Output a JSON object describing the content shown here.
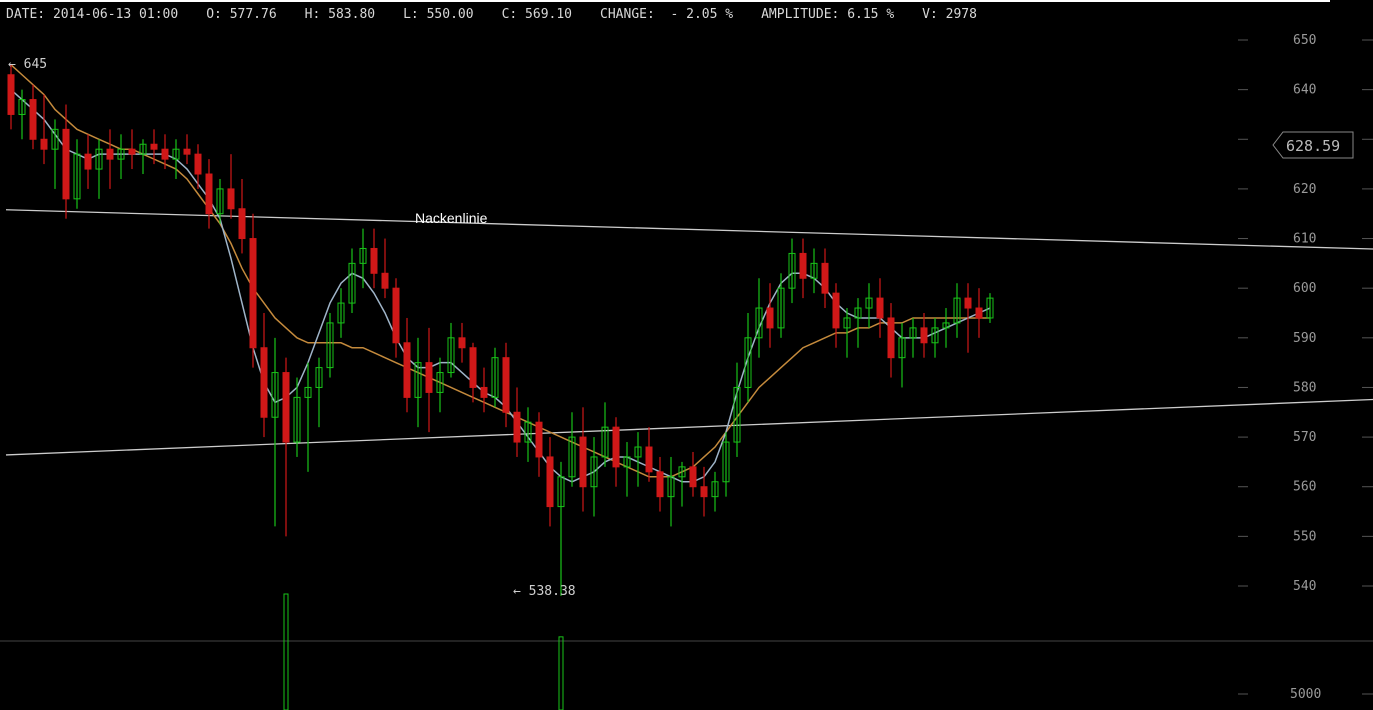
{
  "info_bar": {
    "date_label": "DATE:",
    "date": "2014-06-13 01:00",
    "open_label": "O:",
    "open": "577.76",
    "high_label": "H:",
    "high": "583.80",
    "low_label": "L:",
    "low": "550.00",
    "close_label": "C:",
    "close": "569.10",
    "change_label": "CHANGE:",
    "change": "- 2.05 %",
    "amplitude_label": "AMPLITUDE:",
    "amplitude": "6.15 %",
    "volume_label": "V:",
    "volume": "2978"
  },
  "price_badge": "628.59",
  "colors": {
    "up": "#19c319",
    "down": "#d01818",
    "ma_fast": "#9fb4c8",
    "ma_slow": "#c48a3c",
    "arrow": "#1fa83c",
    "trendline": "#cccccc"
  },
  "chart_data": {
    "type": "candlestick",
    "y_axis": {
      "ticks": [
        540,
        550,
        560,
        570,
        580,
        590,
        600,
        610,
        620,
        630,
        640,
        650
      ],
      "range": [
        533,
        652
      ]
    },
    "volume_axis": {
      "ticks": [
        5000
      ]
    },
    "annotations": {
      "high_marker": "← 645",
      "low_marker": "← 538.38",
      "neckline_label": "Nackenlinie"
    },
    "trendlines": [
      {
        "name": "neckline",
        "from": [
          0,
          615.8
        ],
        "to": [
          248,
          600
        ]
      },
      {
        "name": "support",
        "from": [
          0,
          566.4
        ],
        "to": [
          248,
          588.7
        ]
      }
    ],
    "arrow": {
      "shaft_from": [
        209,
        604.5
      ],
      "tip": [
        216,
        642
      ],
      "left_wing": [
        203,
        629.5
      ],
      "right_wing": [
        225,
        624.3
      ]
    },
    "candles": [
      [
        643,
        645,
        632,
        635
      ],
      [
        635,
        640,
        630,
        638
      ],
      [
        638,
        641,
        628,
        630
      ],
      [
        630,
        639,
        625,
        628
      ],
      [
        628,
        634,
        620,
        632
      ],
      [
        632,
        637,
        614,
        618
      ],
      [
        618,
        630,
        616,
        627
      ],
      [
        627,
        631,
        620,
        624
      ],
      [
        624,
        630,
        618,
        628
      ],
      [
        628,
        632,
        620,
        626
      ],
      [
        626,
        631,
        622,
        628
      ],
      [
        628,
        632,
        624,
        627
      ],
      [
        627,
        630,
        623,
        629
      ],
      [
        629,
        632,
        625,
        628
      ],
      [
        628,
        631,
        624,
        626
      ],
      [
        626,
        630,
        622,
        628
      ],
      [
        628,
        631,
        625,
        627
      ],
      [
        627,
        629,
        620,
        623
      ],
      [
        623,
        626,
        612,
        615
      ],
      [
        615,
        622,
        613,
        620
      ],
      [
        620,
        627,
        614,
        616
      ],
      [
        616,
        622,
        607,
        610
      ],
      [
        610,
        615,
        584,
        588
      ],
      [
        588,
        595,
        570,
        574
      ],
      [
        574,
        590,
        552,
        583
      ],
      [
        583,
        586,
        550,
        569
      ],
      [
        569,
        582,
        566,
        578
      ],
      [
        578,
        585,
        563,
        580
      ],
      [
        580,
        586,
        572,
        584
      ],
      [
        584,
        595,
        582,
        593
      ],
      [
        593,
        600,
        590,
        597
      ],
      [
        597,
        608,
        595,
        605
      ],
      [
        605,
        612,
        600,
        608
      ],
      [
        608,
        612,
        600,
        603
      ],
      [
        603,
        610,
        598,
        600
      ],
      [
        600,
        602,
        586,
        589
      ],
      [
        589,
        594,
        575,
        578
      ],
      [
        578,
        590,
        572,
        585
      ],
      [
        585,
        592,
        571,
        579
      ],
      [
        579,
        586,
        575,
        583
      ],
      [
        583,
        593,
        582,
        590
      ],
      [
        590,
        593,
        585,
        588
      ],
      [
        588,
        589,
        577,
        580
      ],
      [
        580,
        584,
        575,
        578
      ],
      [
        578,
        588,
        576,
        586
      ],
      [
        586,
        589,
        572,
        575
      ],
      [
        575,
        580,
        566,
        569
      ],
      [
        569,
        576,
        565,
        573
      ],
      [
        573,
        575,
        562,
        566
      ],
      [
        566,
        570,
        552,
        556
      ],
      [
        556,
        565,
        538,
        562
      ],
      [
        562,
        575,
        560,
        570
      ],
      [
        570,
        576,
        555,
        560
      ],
      [
        560,
        570,
        554,
        566
      ],
      [
        566,
        577,
        564,
        572
      ],
      [
        572,
        574,
        560,
        564
      ],
      [
        564,
        569,
        558,
        566
      ],
      [
        566,
        571,
        560,
        568
      ],
      [
        568,
        572,
        561,
        563
      ],
      [
        563,
        566,
        555,
        558
      ],
      [
        558,
        566,
        552,
        562
      ],
      [
        562,
        565,
        556,
        564
      ],
      [
        564,
        567,
        558,
        560
      ],
      [
        560,
        564,
        554,
        558
      ],
      [
        558,
        563,
        555,
        561
      ],
      [
        561,
        571,
        558,
        569
      ],
      [
        569,
        585,
        566,
        580
      ],
      [
        580,
        595,
        577,
        590
      ],
      [
        590,
        602,
        586,
        596
      ],
      [
        596,
        601,
        588,
        592
      ],
      [
        592,
        603,
        590,
        600
      ],
      [
        600,
        610,
        597,
        607
      ],
      [
        607,
        610,
        598,
        602
      ],
      [
        602,
        608,
        599,
        605
      ],
      [
        605,
        608,
        596,
        599
      ],
      [
        599,
        601,
        588,
        592
      ],
      [
        592,
        596,
        586,
        594
      ],
      [
        594,
        598,
        588,
        596
      ],
      [
        596,
        601,
        592,
        598
      ],
      [
        598,
        602,
        590,
        594
      ],
      [
        594,
        597,
        582,
        586
      ],
      [
        586,
        593,
        580,
        590
      ],
      [
        590,
        594,
        586,
        592
      ],
      [
        592,
        595,
        586,
        589
      ],
      [
        589,
        594,
        586,
        592
      ],
      [
        592,
        596,
        588,
        593
      ],
      [
        593,
        601,
        590,
        598
      ],
      [
        598,
        601,
        587,
        596
      ],
      [
        596,
        600,
        590,
        594
      ],
      [
        594,
        599,
        593,
        598
      ]
    ],
    "ma_fast": [
      640,
      638,
      636,
      634,
      631,
      628,
      627,
      626,
      627,
      627,
      627,
      627,
      627,
      627,
      627,
      626,
      624,
      621,
      618,
      614,
      606,
      597,
      588,
      581,
      577,
      578,
      580,
      585,
      591,
      597,
      601,
      603,
      602,
      599,
      595,
      590,
      586,
      584,
      584,
      585,
      585,
      583,
      581,
      579,
      578,
      576,
      573,
      570,
      567,
      564,
      562,
      561,
      562,
      563,
      565,
      566,
      566,
      565,
      564,
      563,
      562,
      561,
      561,
      562,
      565,
      571,
      579,
      586,
      592,
      597,
      601,
      603,
      603,
      602,
      600,
      597,
      595,
      594,
      594,
      594,
      592,
      590,
      590,
      590,
      591,
      592,
      593,
      594,
      595,
      596
    ],
    "ma_slow": [
      645,
      643,
      641,
      639,
      636,
      634,
      632,
      631,
      630,
      629,
      628,
      628,
      627,
      626,
      625,
      624,
      622,
      619,
      616,
      613,
      609,
      604,
      600,
      597,
      594,
      592,
      590,
      589,
      589,
      589,
      589,
      588,
      588,
      587,
      586,
      585,
      584,
      583,
      582,
      581,
      580,
      579,
      578,
      577,
      576,
      575,
      574,
      573,
      572,
      571,
      570,
      569,
      568,
      567,
      566,
      565,
      564,
      563,
      562,
      562,
      562,
      563,
      564,
      566,
      568,
      571,
      574,
      577,
      580,
      582,
      584,
      586,
      588,
      589,
      590,
      591,
      591,
      592,
      592,
      593,
      593,
      593,
      594,
      594,
      594,
      594,
      594,
      594,
      594,
      594
    ],
    "volume_bars": [
      {
        "index": 25,
        "value": 5600
      },
      {
        "index": 50,
        "value": 5200
      }
    ]
  }
}
